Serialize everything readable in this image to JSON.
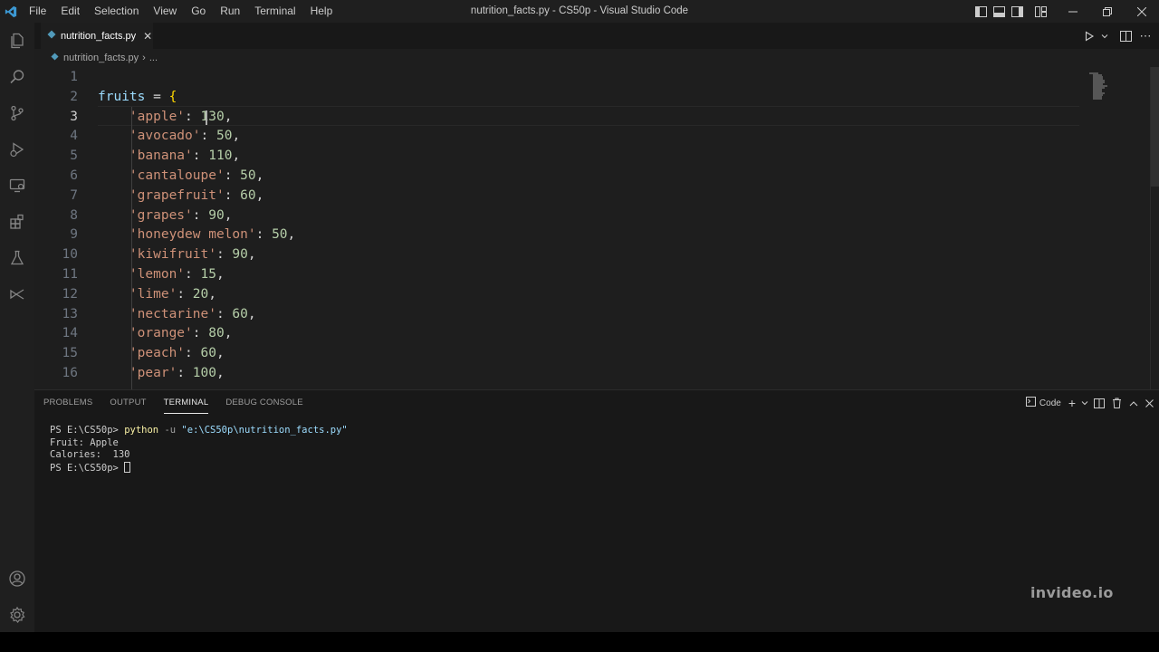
{
  "titlebar": {
    "menu": [
      "File",
      "Edit",
      "Selection",
      "View",
      "Go",
      "Run",
      "Terminal",
      "Help"
    ],
    "window_title": "nutrition_facts.py - CS50p - Visual Studio Code"
  },
  "tab": {
    "label": "nutrition_facts.py"
  },
  "breadcrumb": {
    "file": "nutrition_facts.py",
    "more": "..."
  },
  "editor": {
    "active_line": 3,
    "lines": [
      {
        "n": "1"
      },
      {
        "n": "2",
        "var": "fruits",
        "op": " = ",
        "brace": "{"
      },
      {
        "n": "3",
        "key": "'apple'",
        "sep": ": ",
        "num": "130",
        "end": ","
      },
      {
        "n": "4",
        "key": "'avocado'",
        "sep": ": ",
        "num": "50",
        "end": ","
      },
      {
        "n": "5",
        "key": "'banana'",
        "sep": ": ",
        "num": "110",
        "end": ","
      },
      {
        "n": "6",
        "key": "'cantaloupe'",
        "sep": ": ",
        "num": "50",
        "end": ","
      },
      {
        "n": "7",
        "key": "'grapefruit'",
        "sep": ": ",
        "num": "60",
        "end": ","
      },
      {
        "n": "8",
        "key": "'grapes'",
        "sep": ": ",
        "num": "90",
        "end": ","
      },
      {
        "n": "9",
        "key": "'honeydew melon'",
        "sep": ": ",
        "num": "50",
        "end": ","
      },
      {
        "n": "10",
        "key": "'kiwifruit'",
        "sep": ": ",
        "num": "90",
        "end": ","
      },
      {
        "n": "11",
        "key": "'lemon'",
        "sep": ": ",
        "num": "15",
        "end": ","
      },
      {
        "n": "12",
        "key": "'lime'",
        "sep": ": ",
        "num": "20",
        "end": ","
      },
      {
        "n": "13",
        "key": "'nectarine'",
        "sep": ": ",
        "num": "60",
        "end": ","
      },
      {
        "n": "14",
        "key": "'orange'",
        "sep": ": ",
        "num": "80",
        "end": ","
      },
      {
        "n": "15",
        "key": "'peach'",
        "sep": ": ",
        "num": "60",
        "end": ","
      },
      {
        "n": "16",
        "key": "'pear'",
        "sep": ": ",
        "num": "100",
        "end": ","
      }
    ]
  },
  "panel": {
    "tabs": [
      "PROBLEMS",
      "OUTPUT",
      "TERMINAL",
      "DEBUG CONSOLE"
    ],
    "active_tab": "TERMINAL",
    "shell_label": "Code"
  },
  "terminal": {
    "prompt": "PS E:\\CS50p> ",
    "command": "python",
    "param": " -u ",
    "arg": "\"e:\\CS50p\\nutrition_facts.py\"",
    "output": [
      "Fruit: Apple",
      "Calories:  130"
    ],
    "prompt2": "PS E:\\CS50p> "
  },
  "watermark": "invideo.io",
  "colors": {
    "accent": "#0078d4",
    "python_icon": "#519aba",
    "string": "#ce9178",
    "number": "#b5cea8",
    "variable": "#9cdcfe",
    "brace": "#ffd700"
  }
}
